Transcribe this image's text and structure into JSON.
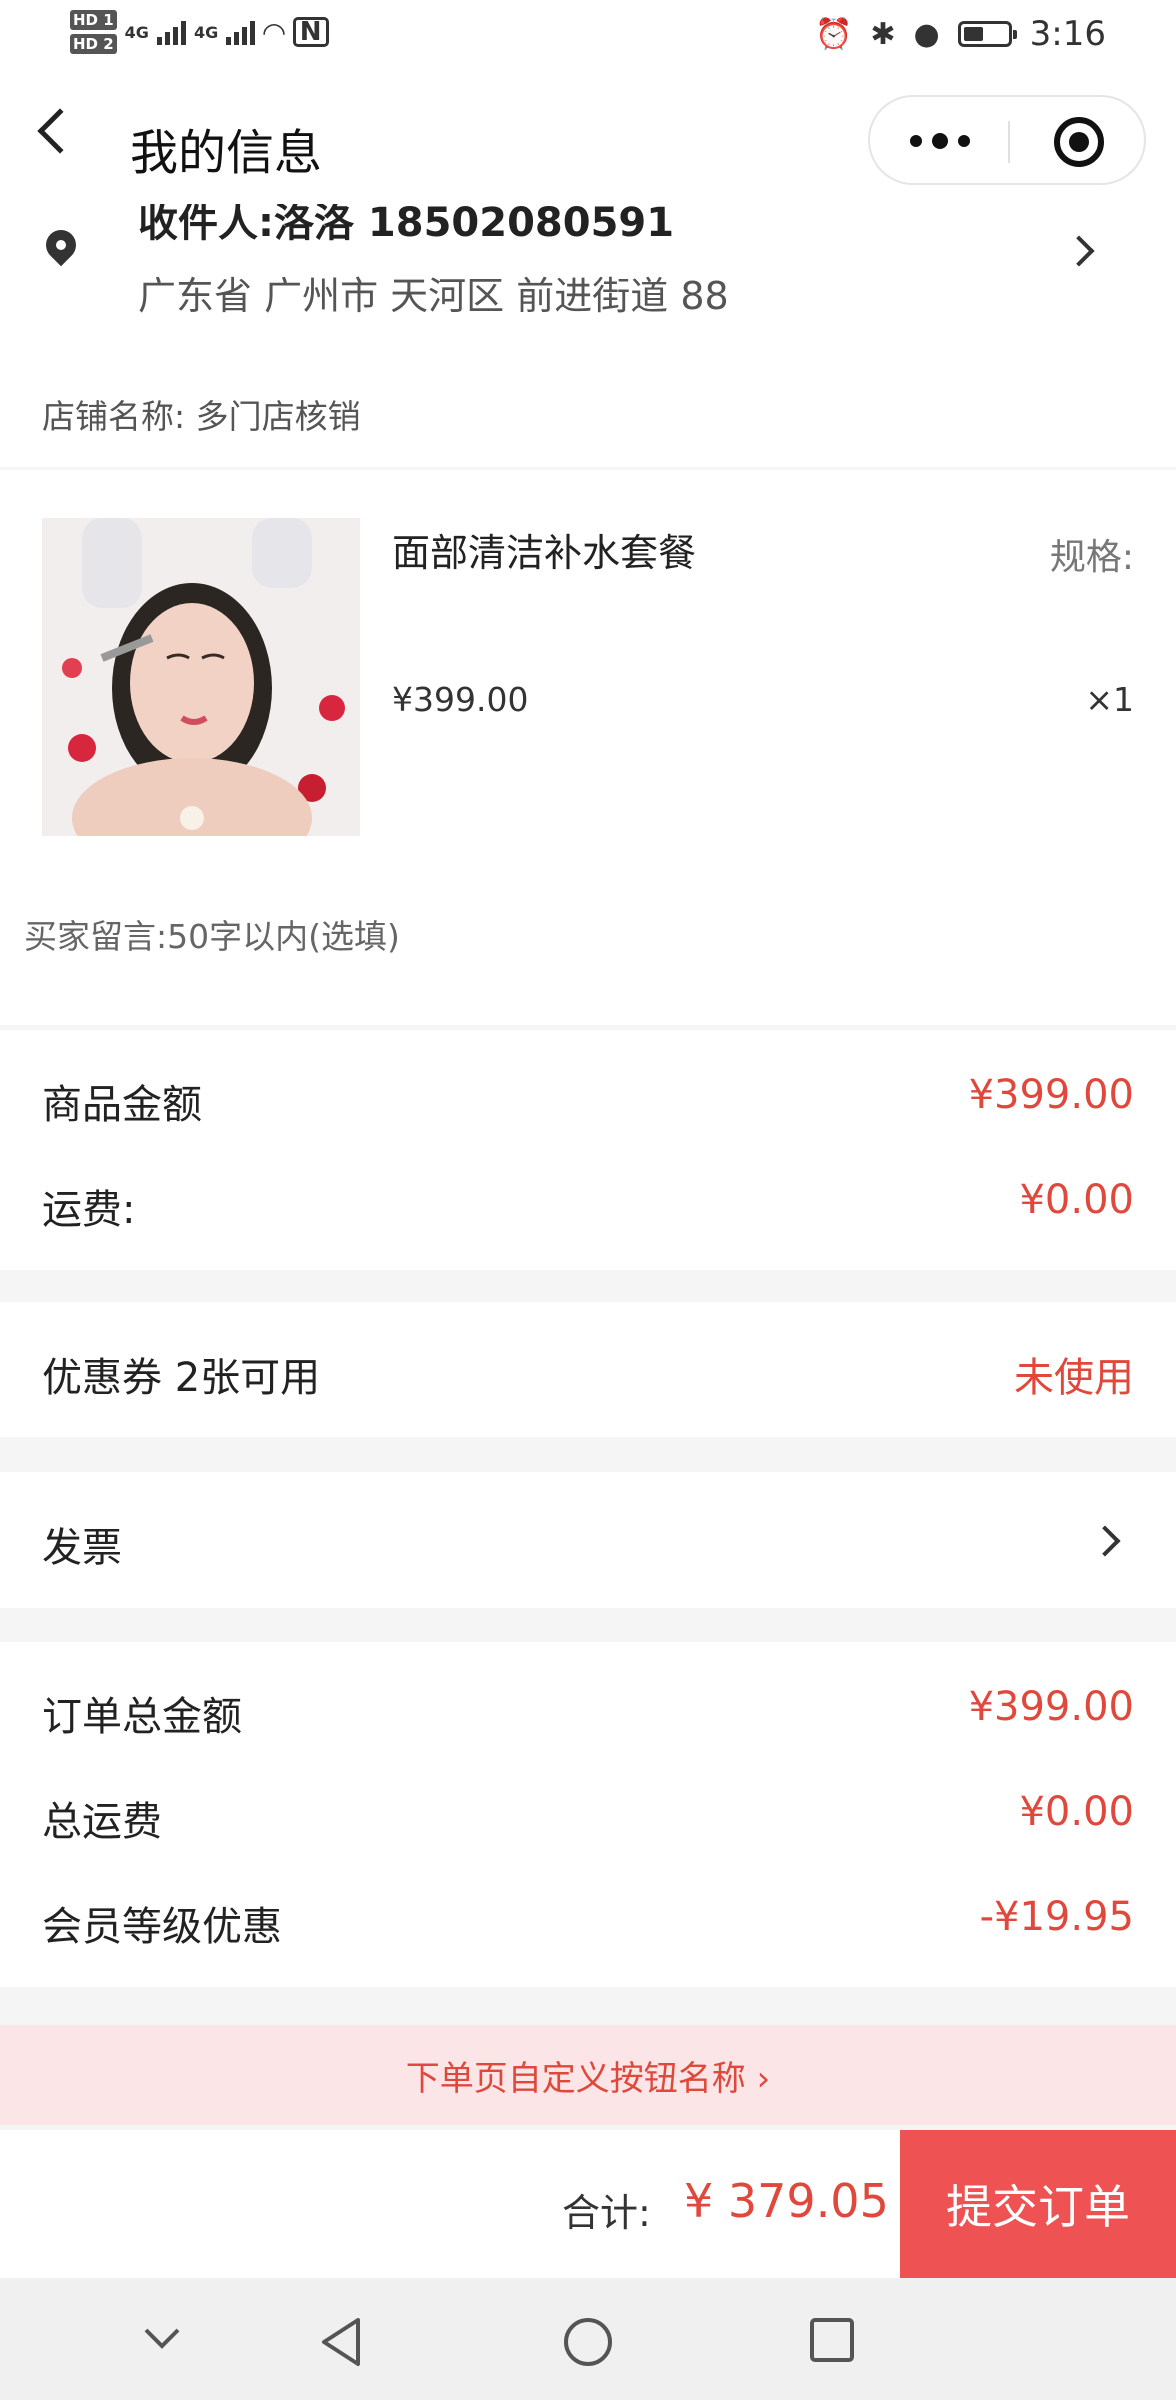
{
  "status_bar": {
    "left": {
      "hd1": "HD 1",
      "hd2": "HD 2",
      "net1": "4G",
      "net2": "4G"
    },
    "time": "3:16"
  },
  "nav": {
    "title": "我的信息"
  },
  "address": {
    "receiver": "收件人:洛洛 18502080591",
    "detail": "广东省 广州市 天河区 前进街道 88"
  },
  "store": {
    "label": "店铺名称:",
    "name": "多门店核销"
  },
  "product": {
    "name": "面部清洁补水套餐",
    "spec_label": "规格:",
    "price": "¥399.00",
    "qty": "×1"
  },
  "buyer_message": {
    "placeholder": "买家留言:50字以内(选填)"
  },
  "amounts": {
    "goods_label": "商品金额",
    "goods_value": "¥399.00",
    "shipping_label": "运费:",
    "shipping_value": "¥0.00"
  },
  "coupon": {
    "label": "优惠券 2张可用",
    "status": "未使用"
  },
  "invoice": {
    "label": "发票"
  },
  "summary": {
    "total_label": "订单总金额",
    "total_value": "¥399.00",
    "shipping_label": "总运费",
    "shipping_value": "¥0.00",
    "member_label": "会员等级优惠",
    "member_value": "-¥19.95"
  },
  "custom_button": {
    "label": "下单页自定义按钮名称 ›"
  },
  "bottom_bar": {
    "total_label": "合计:",
    "total_value": "¥ 379.05",
    "submit_label": "提交订单"
  },
  "colors": {
    "accent": "#e0483c",
    "submit_bg": "#ef5252",
    "custom_btn_bg": "#fbe5e6"
  }
}
